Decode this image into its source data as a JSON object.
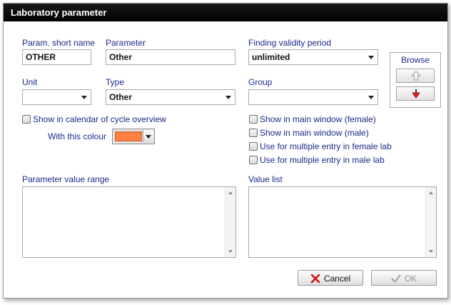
{
  "dialog": {
    "title": "Laboratory parameter"
  },
  "fields": {
    "short_name": {
      "label": "Param. short name",
      "value": "OTHER"
    },
    "parameter": {
      "label": "Parameter",
      "value": "Other"
    },
    "validity": {
      "label": "Finding validity period",
      "value": "unlimited"
    },
    "unit": {
      "label": "Unit",
      "value": ""
    },
    "type": {
      "label": "Type",
      "value": "Other"
    },
    "group": {
      "label": "Group",
      "value": ""
    }
  },
  "calendar": {
    "show_label": "Show in calendar of cycle overview",
    "colour_label": "With this colour",
    "colour_value": "#ff8040"
  },
  "checks": [
    {
      "label": "Show in main window (female)",
      "checked": false
    },
    {
      "label": "Show in main window (male)",
      "checked": false
    },
    {
      "label": "Use for multiple entry in female lab",
      "checked": false
    },
    {
      "label": "Use for multiple entry in male lab",
      "checked": false
    }
  ],
  "browse": {
    "title": "Browse",
    "up_icon": "arrow-up-icon",
    "down_icon": "arrow-down-red-icon"
  },
  "value_range": {
    "label": "Parameter value range",
    "value": ""
  },
  "value_list": {
    "label": "Value list",
    "value": ""
  },
  "buttons": {
    "cancel": {
      "label": "Cancel",
      "icon": "x-red-icon"
    },
    "ok": {
      "label": "OK",
      "icon": "checkmark-gray-icon",
      "enabled": false
    }
  },
  "colors": {
    "label_text": "#1b2a88",
    "titlebar": "#000000",
    "accent_red": "#e02020"
  }
}
